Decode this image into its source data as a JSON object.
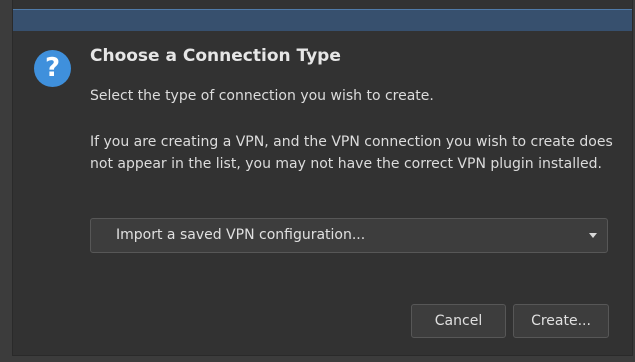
{
  "dialog": {
    "icon": "question-icon",
    "icon_glyph": "?",
    "title": "Choose a Connection Type",
    "subtitle": "Select the type of connection you wish to create.",
    "info": "If you are creating a VPN, and the VPN connection you wish to create does not appear in the list, you may not have the correct VPN plugin installed."
  },
  "connection_type": {
    "selected": "Import a saved VPN configuration..."
  },
  "buttons": {
    "cancel": "Cancel",
    "create": "Create..."
  },
  "colors": {
    "titlebar": "#37506e",
    "icon_bg": "#3f90dc",
    "background": "#323232"
  }
}
